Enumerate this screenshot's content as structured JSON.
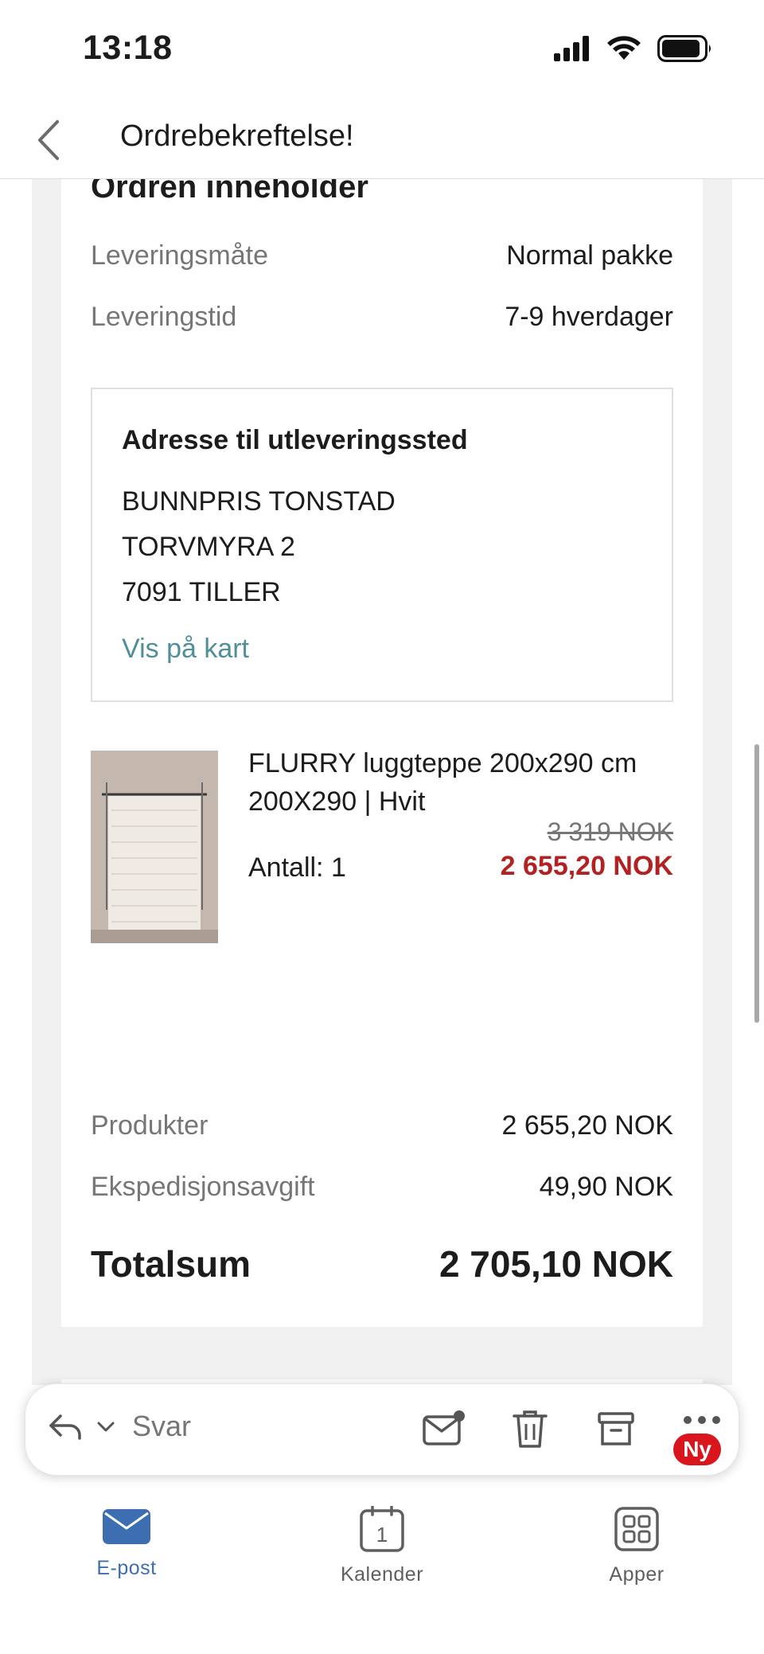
{
  "status_bar": {
    "time": "13:18"
  },
  "header": {
    "title": "Ordrebekreftelse!"
  },
  "order": {
    "section_title": "Ordren inneholder",
    "delivery_method_label": "Leveringsmåte",
    "delivery_method_value": "Normal pakke",
    "delivery_time_label": "Leveringstid",
    "delivery_time_value": "7-9 hverdager",
    "address": {
      "title": "Adresse til utleveringssted",
      "line1": "BUNNPRIS TONSTAD",
      "line2": "TORVMYRA 2",
      "line3": "7091 TILLER",
      "map_link": "Vis på kart"
    },
    "product": {
      "name": "FLURRY luggteppe 200x290 cm",
      "variant": "200X290  |  Hvit",
      "price_old": "3 319 NOK",
      "quantity": "Antall: 1",
      "price_new": "2 655,20 NOK"
    }
  },
  "summary": {
    "products_label": "Produkter",
    "products_value": "2 655,20 NOK",
    "fee_label": "Ekspedisjonsavgift",
    "fee_value": "49,90 NOK",
    "total_label": "Totalsum",
    "total_value": "2 705,10 NOK"
  },
  "action_bar": {
    "reply_label": "Svar",
    "badge": "Ny"
  },
  "tabs": [
    {
      "label": "E-post",
      "icon": "mail-icon",
      "active": true
    },
    {
      "label": "Kalender",
      "icon": "calendar-icon",
      "day": "1"
    },
    {
      "label": "Apper",
      "icon": "apps-grid-icon"
    }
  ],
  "colors": {
    "accent_blue": "#3e6eb2",
    "link_teal": "#4f8f9a",
    "sale_red": "#b22222",
    "badge_red": "#d9161d"
  }
}
